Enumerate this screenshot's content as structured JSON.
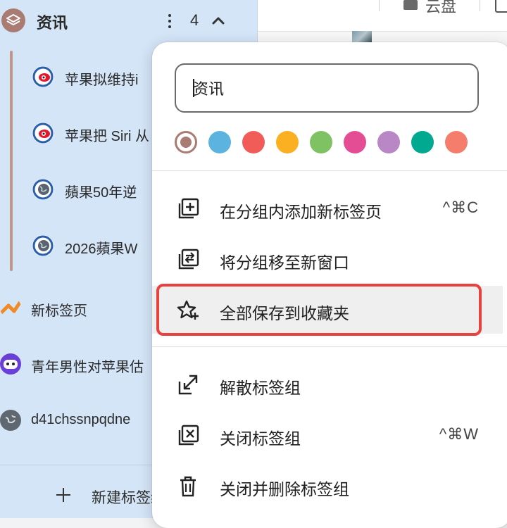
{
  "sidebar": {
    "group": {
      "title": "资讯",
      "count": "4"
    },
    "group_tabs": [
      {
        "label": "苹果拟维持i"
      },
      {
        "label": "苹果把 Siri 从"
      },
      {
        "label": "蘋果50年逆"
      },
      {
        "label": "2026蘋果W"
      }
    ],
    "tabs": [
      {
        "label": "新标签页"
      },
      {
        "label": "青年男性对苹果估"
      },
      {
        "label": "d41chssnpqdne"
      }
    ],
    "new_group_label": "新建标签组"
  },
  "content": {
    "topbar_label": "云盘"
  },
  "menu": {
    "name_input_value": "资讯",
    "colors": [
      {
        "name": "brown",
        "hex": "#a97b73",
        "selected": true
      },
      {
        "name": "blue",
        "hex": "#5cb3e0",
        "selected": false
      },
      {
        "name": "red",
        "hex": "#f25c58",
        "selected": false
      },
      {
        "name": "yellow",
        "hex": "#fbb021",
        "selected": false
      },
      {
        "name": "green",
        "hex": "#7fc263",
        "selected": false
      },
      {
        "name": "pink",
        "hex": "#e44c93",
        "selected": false
      },
      {
        "name": "purple",
        "hex": "#b987c6",
        "selected": false
      },
      {
        "name": "teal",
        "hex": "#00a98f",
        "selected": false
      },
      {
        "name": "orange",
        "hex": "#f47e6b",
        "selected": false
      }
    ],
    "items": [
      {
        "id": "add-tab",
        "label": "在分组内添加新标签页",
        "shortcut": "^⌘C",
        "icon": "add-tab-icon"
      },
      {
        "id": "move-window",
        "label": "将分组移至新窗口",
        "shortcut": "",
        "icon": "move-to-window-icon"
      },
      {
        "id": "save-bookmarks",
        "label": "全部保存到收藏夹",
        "shortcut": "",
        "icon": "star-add-icon"
      },
      {
        "id": "ungroup",
        "label": "解散标签组",
        "shortcut": "",
        "icon": "ungroup-icon"
      },
      {
        "id": "close-group",
        "label": "关闭标签组",
        "shortcut": "^⌘W",
        "icon": "close-box-icon"
      },
      {
        "id": "close-delete",
        "label": "关闭并删除标签组",
        "shortcut": "",
        "icon": "trash-icon"
      }
    ]
  }
}
